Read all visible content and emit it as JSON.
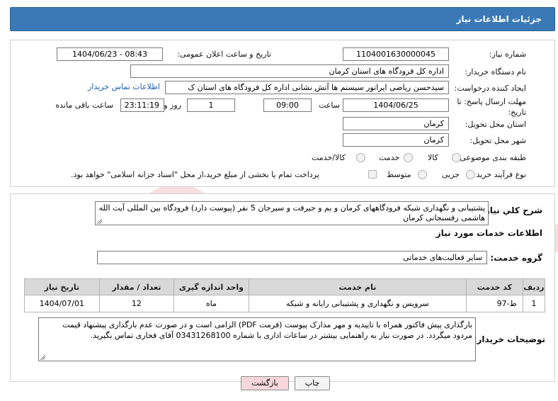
{
  "header": {
    "title": "جزئیات اطلاعات نیاز"
  },
  "form": {
    "need_number_label": "شماره نیاز:",
    "need_number": "1104001630000045",
    "announce_label": "تاریخ و ساعت اعلان عمومی:",
    "announce_value": "1404/06/23 - 08:43",
    "buyer_org_label": "نام دستگاه خریدار:",
    "buyer_org": "اداره کل فرودگاه های استان کرمان",
    "requester_label": "ایجاد کننده درخواست:",
    "requester": "سیدحسن ریاضی اپراتور سیستم ها آتش نشانی اداره کل فرودگاه های استان ک",
    "buyer_contact_link": "اطلاعات تماس خریدار",
    "deadline_label": "مهلت ارسال پاسخ: تا تاریخ:",
    "deadline_date": "1404/06/25",
    "time_label": "ساعت",
    "deadline_time": "09:00",
    "days_value": "1",
    "days_label": "روز و",
    "remaining_time": "23:11:19",
    "remaining_label": "ساعت باقی مانده",
    "province_label": "استان محل تحویل:",
    "province": "کرمان",
    "city_label": "شهر محل تحویل:",
    "city": "کرمان",
    "category_label": "طبقه بندی موضوعی:",
    "category_options": [
      "کالا",
      "خدمت",
      "کالا/خدمت"
    ],
    "process_label": "نوع فرآیند خرید :",
    "process_options": [
      "جزیی",
      "متوسط"
    ],
    "payment_note": "پرداخت تمام یا بخشی از مبلغ خرید،از محل \"اسناد خزانه اسلامی\" خواهد بود."
  },
  "summary": {
    "label": "شرح کلي نياز:",
    "text": "پشتیبانی و نگهداری شبکه فرودگاههای کرمان و بم و جیرفت و سیرجان 5 نفر (پیوست دارد) فرودگاه بین المللی آیت الله هاشمی رفسنجانی کرمان"
  },
  "services": {
    "section_title": "اطلاعات خدمات مورد نیاز",
    "group_label": "گروه خدمت:",
    "group_value": "سایر فعالیت‌های خدماتی",
    "columns": [
      "ردیف",
      "کد خدمت",
      "نام خدمت",
      "واحد اندازه گیری",
      "تعداد / مقدار",
      "تاریخ نیاز"
    ],
    "rows": [
      [
        "1",
        "ط-97",
        "سرویس و نگهداری و پشتیبانی رایانه و شبکه",
        "ماه",
        "12",
        "1404/07/01"
      ]
    ]
  },
  "buyer_notes": {
    "label": "توضیحات خریدار:",
    "text": "بارگذاری پیش فاکتور همراه با تاییدیه و مهر مدارک پیوست  (فرمت PDF) الزامی است و در صورت عدم بارگذاری پیشنهاد قیمت مردود میگردد. در صورت نیاز به راهنمایی بیشتر در ساعات اداری با شماره  03431268100 آقای فخاری  تماس بگیرید."
  },
  "buttons": {
    "print": "چاپ",
    "back": "بازگشت"
  },
  "watermark": {
    "text": "AriaTender.neT"
  },
  "colors": {
    "header": "#3a79b6",
    "link": "#1f5fae",
    "back_button": "#f8d7dc"
  }
}
